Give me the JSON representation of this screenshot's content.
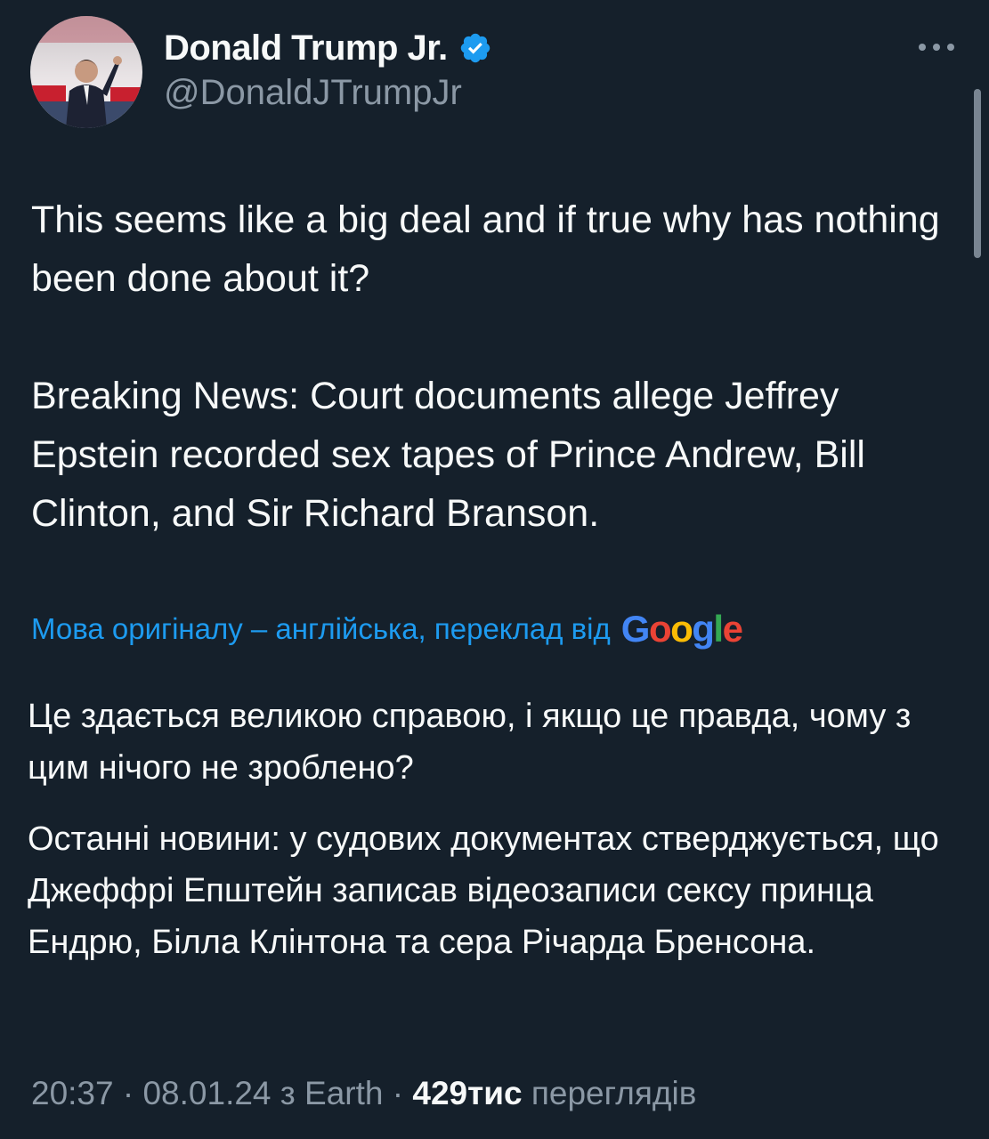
{
  "author": {
    "display_name": "Donald Trump Jr.",
    "handle": "@DonaldJTrumpJr",
    "verified": true
  },
  "tweet": {
    "paragraphs": [
      "This seems like a big deal and if true why has nothing been done about it?",
      "Breaking News: Court documents allege Jeffrey Epstein recorded sex tapes of Prince Andrew, Bill Clinton, and Sir Richard Branson."
    ]
  },
  "translation": {
    "note": "Мова оригіналу – англійська, переклад від",
    "provider_logo": {
      "letters": [
        "G",
        "o",
        "o",
        "g",
        "l",
        "e"
      ],
      "colors": [
        "#4285f4",
        "#ea4335",
        "#fbbc05",
        "#4285f4",
        "#34a853",
        "#ea4335"
      ]
    },
    "paragraphs": [
      "Це здається великою справою, і якщо це правда, чому з цим нічого не зроблено?",
      "Останні новини: у судових документах стверджується, що Джеффрі Епштейн записав відеозаписи сексу принца Ендрю, Білла Клінтона та сера Річарда Бренсона."
    ]
  },
  "meta": {
    "time": "20:37",
    "separator": "·",
    "date": "08.01.24",
    "source": "з Earth",
    "views_count": "429тис",
    "views_label": "переглядів"
  },
  "icons": {
    "verified": "verified-badge-icon",
    "more": "more-options-icon"
  },
  "colors": {
    "background": "#15202b",
    "text": "#f7f9f9",
    "secondary_text": "#8b98a5",
    "link": "#1d9bf0",
    "verified_badge": "#1d9bf0"
  }
}
